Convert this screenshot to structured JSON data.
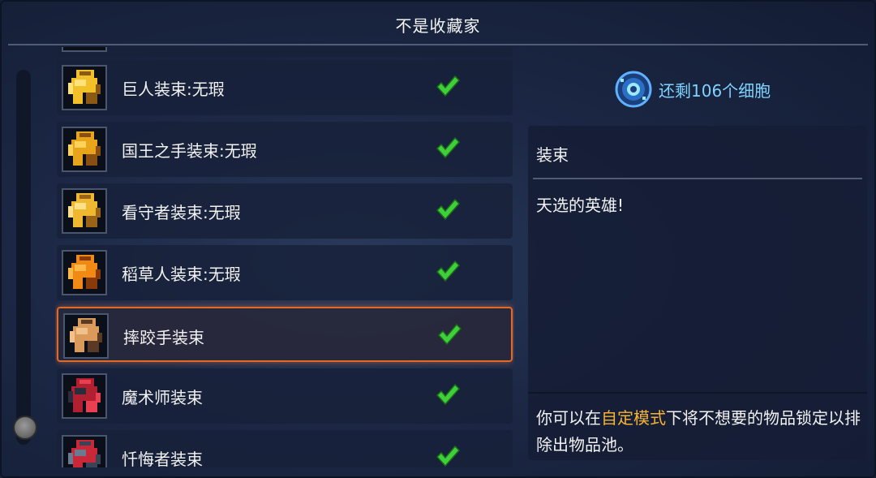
{
  "header": {
    "title": "不是收藏家"
  },
  "list": {
    "items": [
      {
        "label": "巨人装束:无瑕",
        "icon": "giant-outfit-icon",
        "colors": [
          "#f2c028",
          "#ffe27a",
          "#8a5a14"
        ],
        "checked": true,
        "selected": false
      },
      {
        "label": "国王之手装束:无瑕",
        "icon": "hand-of-king-outfit-icon",
        "colors": [
          "#e8a51c",
          "#ffd35a",
          "#8a4e10"
        ],
        "checked": true,
        "selected": false
      },
      {
        "label": "看守者装束:无瑕",
        "icon": "guardian-outfit-icon",
        "colors": [
          "#f0b830",
          "#ffe08a",
          "#9a6418"
        ],
        "checked": true,
        "selected": false
      },
      {
        "label": "稻草人装束:无瑕",
        "icon": "scarecrow-outfit-icon",
        "colors": [
          "#f08a14",
          "#ffb84a",
          "#8a3a08"
        ],
        "checked": true,
        "selected": false
      },
      {
        "label": "摔跤手装束",
        "icon": "wrestler-outfit-icon",
        "colors": [
          "#d99a5c",
          "#f2c08a",
          "#5a3a24"
        ],
        "checked": true,
        "selected": true
      },
      {
        "label": "魔术师装束",
        "icon": "magician-outfit-icon",
        "colors": [
          "#b02030",
          "#2a2e3c",
          "#e84050"
        ],
        "checked": true,
        "selected": false
      },
      {
        "label": "忏悔者装束",
        "icon": "penitent-outfit-icon",
        "colors": [
          "#c82838",
          "#6a7a90",
          "#3a4458"
        ],
        "checked": true,
        "selected": false
      }
    ]
  },
  "cells": {
    "text": "还剩106个细胞",
    "icon": "cell-icon",
    "color": "#7fd3ff"
  },
  "details": {
    "heading": "装束",
    "description": "天选的英雄!",
    "note_before": "你可以在",
    "note_highlight": "自定模式",
    "note_after": "下将不想要的物品锁定以排除出物品池。",
    "highlight_color": "#f5b334"
  },
  "colors": {
    "accent_selected": "#e06a2a",
    "check": "#3fcf3a"
  }
}
